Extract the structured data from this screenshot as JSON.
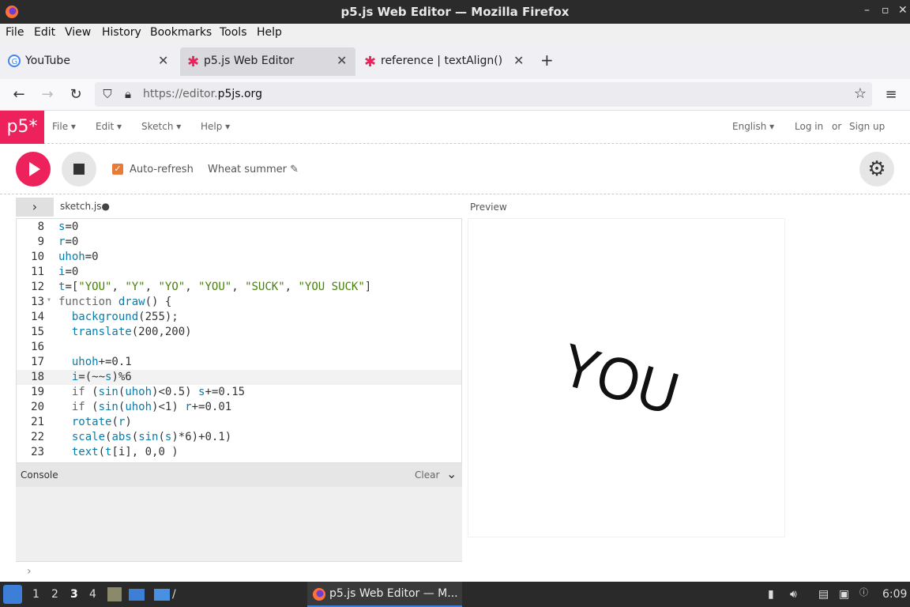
{
  "window": {
    "title": "p5.js Web Editor — Mozilla Firefox"
  },
  "menubar": {
    "items": [
      "File",
      "Edit",
      "View",
      "History",
      "Bookmarks",
      "Tools",
      "Help"
    ]
  },
  "tabs": [
    {
      "label": "YouTube",
      "icon": "google-icon"
    },
    {
      "label": "p5.js Web Editor",
      "icon": "p5-asterisk-icon",
      "active": true
    },
    {
      "label": "reference | textAlign()",
      "icon": "p5-asterisk-icon"
    }
  ],
  "nav": {
    "url_prefix": "https://editor.",
    "url_domain": "p5js.org"
  },
  "p5header": {
    "logo": "p5*",
    "menus": [
      "File ▾",
      "Edit ▾",
      "Sketch ▾",
      "Help ▾"
    ],
    "language": "English ▾",
    "login": "Log in",
    "or": "or",
    "signup": "Sign up"
  },
  "toolbar": {
    "auto_refresh_label": "Auto-refresh",
    "auto_refresh_checked": true,
    "sketch_name": "Wheat summer ✎"
  },
  "editor": {
    "filename": "sketch.js",
    "lines": [
      {
        "n": "8",
        "code": "s=0"
      },
      {
        "n": "9",
        "code": "r=0"
      },
      {
        "n": "10",
        "code": "uhoh=0"
      },
      {
        "n": "11",
        "code": "i=0"
      },
      {
        "n": "12",
        "code": "t=[\"YOU\", \"Y\", \"YO\", \"YOU\", \"SUCK\", \"YOU SUCK\"]"
      },
      {
        "n": "13",
        "code": "function draw() {"
      },
      {
        "n": "14",
        "code": "  background(255);"
      },
      {
        "n": "15",
        "code": "  translate(200,200)"
      },
      {
        "n": "16",
        "code": ""
      },
      {
        "n": "17",
        "code": "  uhoh+=0.1"
      },
      {
        "n": "18",
        "code": "  i=(~~s)%6"
      },
      {
        "n": "19",
        "code": "  if (sin(uhoh)<0.5) s+=0.15"
      },
      {
        "n": "20",
        "code": "  if (sin(uhoh)<1) r+=0.01"
      },
      {
        "n": "21",
        "code": "  rotate(r)"
      },
      {
        "n": "22",
        "code": "  scale(abs(sin(s)*6)+0.1)"
      },
      {
        "n": "23",
        "code": "  text(t[i], 0,0 )"
      }
    ]
  },
  "console": {
    "title": "Console",
    "clear": "Clear",
    "prompt": "›"
  },
  "preview": {
    "label": "Preview",
    "rendered_text": "YOU"
  },
  "taskbar": {
    "workspaces": [
      "1",
      "2",
      "3",
      "4"
    ],
    "active_window": "p5.js Web Editor — M...",
    "time": "6:09"
  }
}
